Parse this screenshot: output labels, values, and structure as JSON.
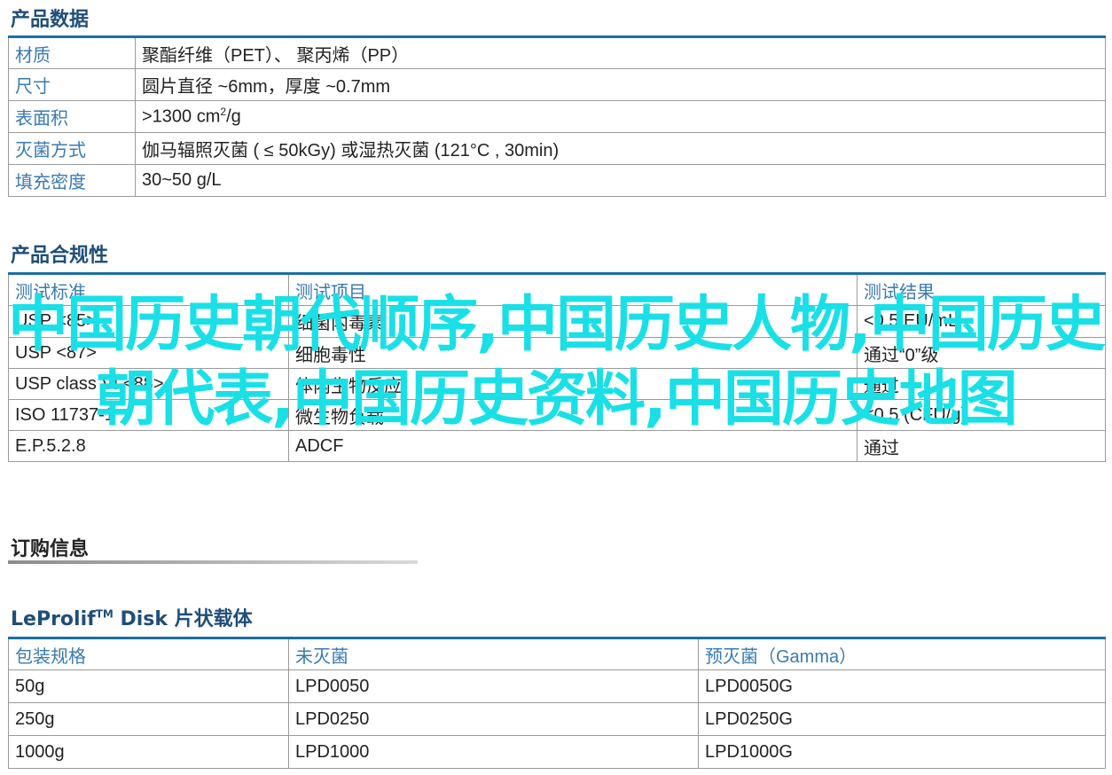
{
  "product_data": {
    "title": "产品数据",
    "rows": [
      {
        "label": "材质",
        "value": "聚酯纤维（PET）、 聚丙烯（PP）"
      },
      {
        "label": "尺寸",
        "value": "圆片直径 ~6mm，厚度 ~0.7mm"
      },
      {
        "label": "表面积",
        "value_prefix": ">1300 cm",
        "value_sup": "2",
        "value_suffix": "/g"
      },
      {
        "label": "灭菌方式",
        "value": "伽马辐照灭菌 ( ≤ 50kGy) 或湿热灭菌 (121°C , 30min)"
      },
      {
        "label": "填充密度",
        "value": "30~50 g/L"
      }
    ]
  },
  "compliance": {
    "title": "产品合规性",
    "headers": [
      "测试标准",
      "测试项目",
      "测试结果"
    ],
    "rows": [
      [
        "USP <85>",
        "细菌内毒素",
        "<0.5 EU/mL"
      ],
      [
        "USP <87>",
        "细胞毒性",
        "通过“0”级"
      ],
      [
        "USP class VI <88>",
        "体内生物反应",
        "通过"
      ],
      [
        "ISO 11737-1",
        "微生物负载",
        "<0.5 (CFU/g)"
      ],
      [
        "E.P.5.2.8",
        "ADCF",
        "通过"
      ]
    ]
  },
  "order_info": {
    "title": "订购信息"
  },
  "disk_table": {
    "title_prefix": "LeProlif",
    "title_sup": "TM",
    "title_suffix": " Disk 片状载体",
    "headers": [
      "包装规格",
      "未灭菌",
      "预灭菌（Gamma）"
    ],
    "rows": [
      [
        "50g",
        "LPD0050",
        "LPD0050G"
      ],
      [
        "250g",
        "LPD0250",
        "LPD0250G"
      ],
      [
        "1000g",
        "LPD1000",
        "LPD1000G"
      ]
    ]
  },
  "watermark": "中国历史朝代顺序,中国历史人物,中国历史朝代表,中国历史资料,中国历史地图",
  "colors": {
    "accent": "#1b6fa6",
    "label": "#3a7bb0",
    "watermark": "#19e0e6"
  }
}
